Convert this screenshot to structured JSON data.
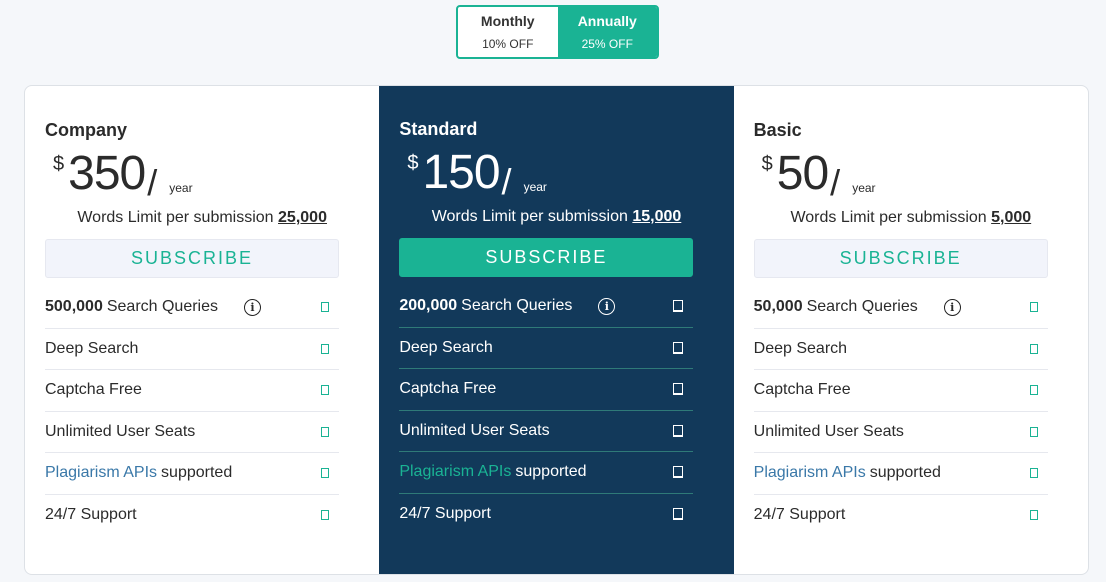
{
  "billing_toggle": {
    "monthly": {
      "label": "Monthly",
      "discount": "10% OFF"
    },
    "annually": {
      "label": "Annually",
      "discount": "25% OFF"
    },
    "selected": "annually"
  },
  "colors": {
    "accent": "#1ab394",
    "featured_bg": "#12395a",
    "link": "#3a78a8"
  },
  "plans": [
    {
      "name": "Company",
      "currency": "$",
      "amount": "350",
      "slash": "/",
      "period": "year",
      "limit_label": "Words Limit per submission",
      "limit_value": "25,000",
      "subscribe_label": "SUBSCRIBE",
      "features": {
        "queries_count": "500,000",
        "queries_label": "Search Queries",
        "deep_search": "Deep Search",
        "captcha_free": "Captcha Free",
        "unlimited_seats": "Unlimited User Seats",
        "apis_link": "Plagiarism APIs",
        "apis_suffix": "supported",
        "support": "24/7 Support"
      }
    },
    {
      "name": "Standard",
      "currency": "$",
      "amount": "150",
      "slash": "/",
      "period": "year",
      "limit_label": "Words Limit per submission",
      "limit_value": "15,000",
      "subscribe_label": "SUBSCRIBE",
      "features": {
        "queries_count": "200,000",
        "queries_label": "Search Queries",
        "deep_search": "Deep Search",
        "captcha_free": "Captcha Free",
        "unlimited_seats": "Unlimited User Seats",
        "apis_link": "Plagiarism APIs",
        "apis_suffix": "supported",
        "support": "24/7 Support"
      }
    },
    {
      "name": "Basic",
      "currency": "$",
      "amount": "50",
      "slash": "/",
      "period": "year",
      "limit_label": "Words Limit per submission",
      "limit_value": "5,000",
      "subscribe_label": "SUBSCRIBE",
      "features": {
        "queries_count": "50,000",
        "queries_label": "Search Queries",
        "deep_search": "Deep Search",
        "captcha_free": "Captcha Free",
        "unlimited_seats": "Unlimited User Seats",
        "apis_link": "Plagiarism APIs",
        "apis_suffix": "supported",
        "support": "24/7 Support"
      }
    }
  ],
  "icons": {
    "info": "info-icon",
    "check": "check-icon"
  }
}
